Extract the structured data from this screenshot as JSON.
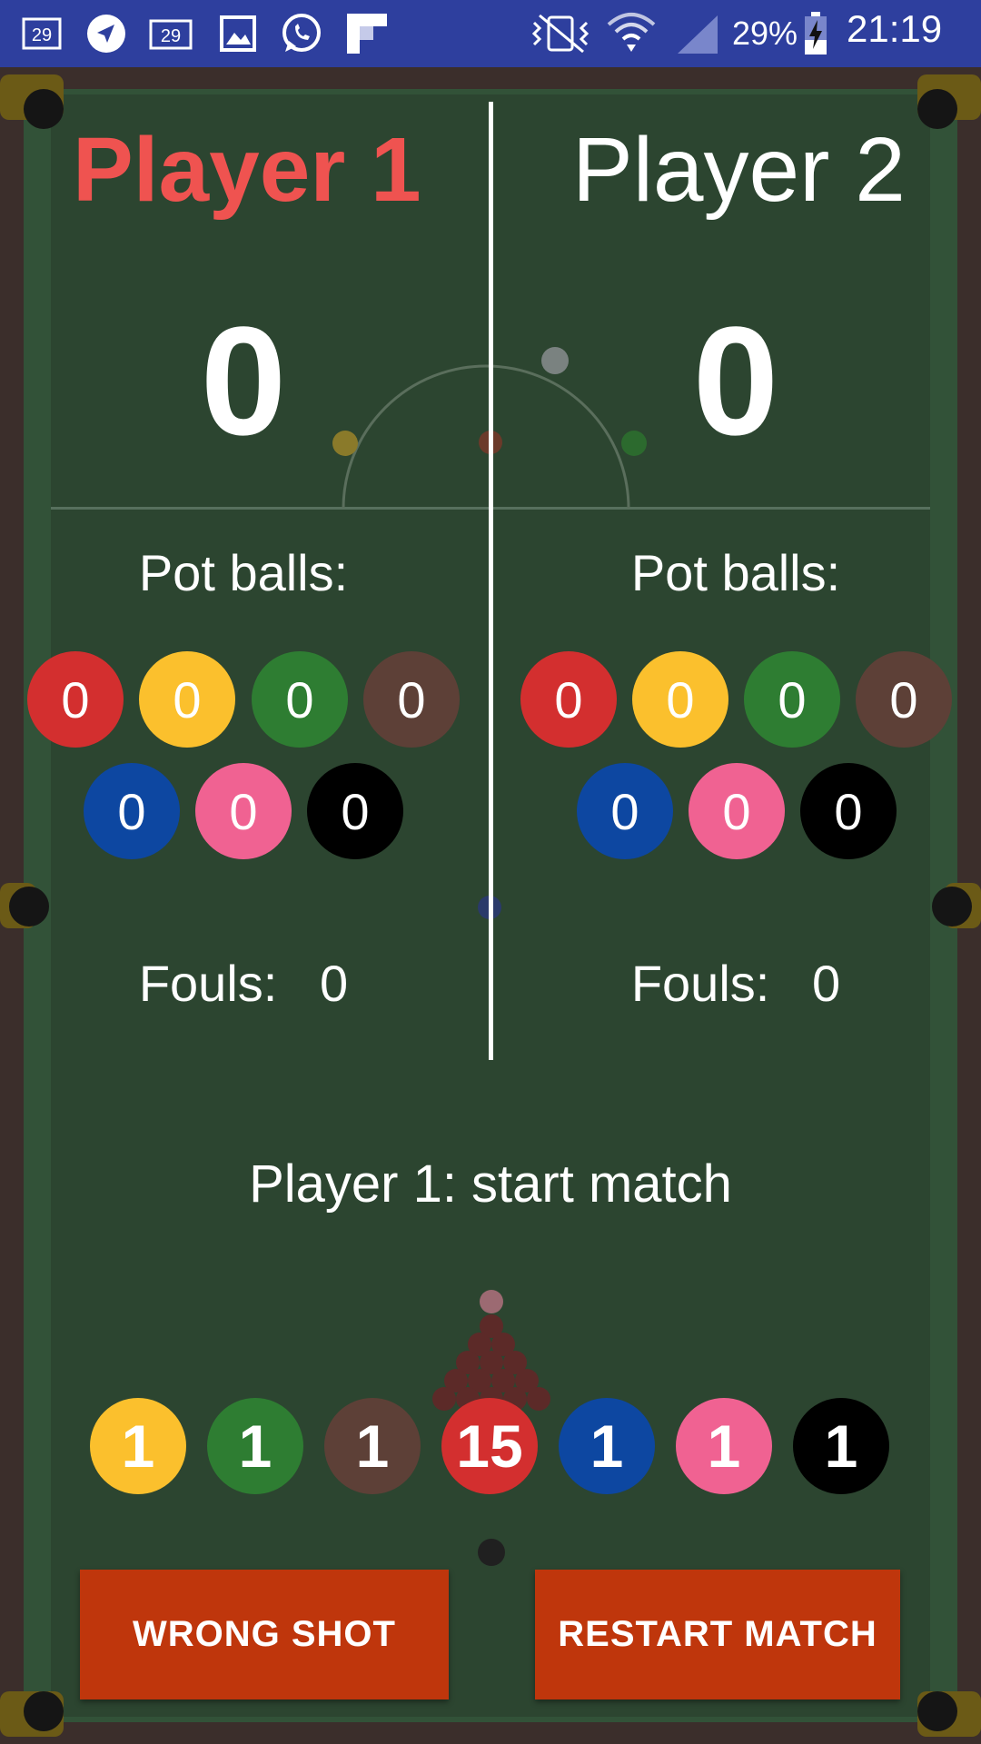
{
  "status_bar": {
    "left_icons": [
      "notification-29-icon",
      "navigation-icon",
      "calendar-29-icon",
      "image-icon",
      "whatsapp-icon",
      "flipboard-icon"
    ],
    "cal_day": "29",
    "right_icons": [
      "vibrate-icon",
      "wifi-icon",
      "signal-icon",
      "battery-charging-icon"
    ],
    "battery_percent": "29%",
    "time": "21:19"
  },
  "players": [
    {
      "name": "Player 1",
      "score": "0",
      "pot_label": "Pot balls:",
      "pot_balls": [
        {
          "color": "red",
          "count": "0"
        },
        {
          "color": "yellow",
          "count": "0"
        },
        {
          "color": "green",
          "count": "0"
        },
        {
          "color": "brown",
          "count": "0"
        },
        {
          "color": "blue",
          "count": "0"
        },
        {
          "color": "pink",
          "count": "0"
        },
        {
          "color": "black",
          "count": "0"
        }
      ],
      "fouls_label": "Fouls:",
      "fouls": "0"
    },
    {
      "name": "Player 2",
      "score": "0",
      "pot_label": "Pot balls:",
      "pot_balls": [
        {
          "color": "red",
          "count": "0"
        },
        {
          "color": "yellow",
          "count": "0"
        },
        {
          "color": "green",
          "count": "0"
        },
        {
          "color": "brown",
          "count": "0"
        },
        {
          "color": "blue",
          "count": "0"
        },
        {
          "color": "pink",
          "count": "0"
        },
        {
          "color": "black",
          "count": "0"
        }
      ],
      "fouls_label": "Fouls:",
      "fouls": "0"
    }
  ],
  "active_player": "Player 1",
  "status_message": "Player 1:  start match",
  "remaining_balls": [
    {
      "color": "yellow",
      "count": "1"
    },
    {
      "color": "green",
      "count": "1"
    },
    {
      "color": "brown",
      "count": "1"
    },
    {
      "color": "red",
      "count": "15"
    },
    {
      "color": "blue",
      "count": "1"
    },
    {
      "color": "pink",
      "count": "1"
    },
    {
      "color": "black",
      "count": "1"
    }
  ],
  "buttons": {
    "wrong_shot": "WRONG SHOT",
    "restart_match": "RESTART MATCH"
  },
  "colors": {
    "status_bar": "#2e3f9e",
    "felt": "#2c4530",
    "active_player_name": "#ef5350",
    "button": "#bf360c",
    "red": "#d32f2f",
    "yellow": "#fbc02d",
    "green": "#2e7d32",
    "brown": "#5d4037",
    "blue": "#0d47a1",
    "pink": "#f06292",
    "black": "#000000"
  }
}
